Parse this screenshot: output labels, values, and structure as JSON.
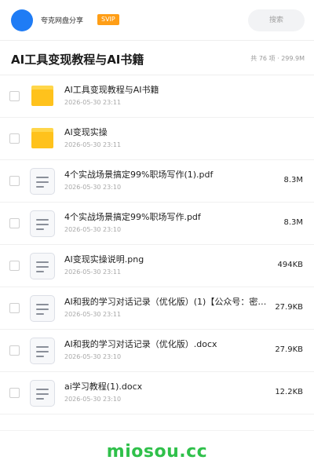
{
  "topbar": {
    "username": "夸克网盘分享",
    "badge": "SVIP",
    "search_placeholder": "搜索"
  },
  "header": {
    "title": "AI工具变现教程与AI书籍",
    "stats": "共 76 项 · 299.9M"
  },
  "items": [
    {
      "type": "folder",
      "name": "AI工具变现教程与AI书籍",
      "date": "2026-05-30 23:11",
      "size": ""
    },
    {
      "type": "folder",
      "name": "AI变现实操",
      "date": "2026-05-30 23:11",
      "size": ""
    },
    {
      "type": "file",
      "name": "4个实战场景搞定99%职场写作(1).pdf",
      "date": "2026-05-30 23:10",
      "size": "8.3M"
    },
    {
      "type": "file",
      "name": "4个实战场景搞定99%职场写作.pdf",
      "date": "2026-05-30 23:10",
      "size": "8.3M"
    },
    {
      "type": "file",
      "name": "AI变现实操说明.png",
      "date": "2026-05-30 23:11",
      "size": "494KB"
    },
    {
      "type": "file",
      "name": "AI和我的学习对话记录（优化版）(1)【公众号：密…",
      "date": "2026-05-30 23:11",
      "size": "27.9KB"
    },
    {
      "type": "file",
      "name": "AI和我的学习对话记录（优化版）.docx",
      "date": "2026-05-30 23:10",
      "size": "27.9KB"
    },
    {
      "type": "file",
      "name": "ai学习教程(1).docx",
      "date": "2026-05-30 23:10",
      "size": "12.2KB"
    }
  ],
  "footer": {
    "watermark": "miosou.cc"
  },
  "colors": {
    "avatar": "#1f7cf5",
    "badge": "#ff9e16",
    "folder": "#ffc21c",
    "watermark": "#2fc04a"
  }
}
